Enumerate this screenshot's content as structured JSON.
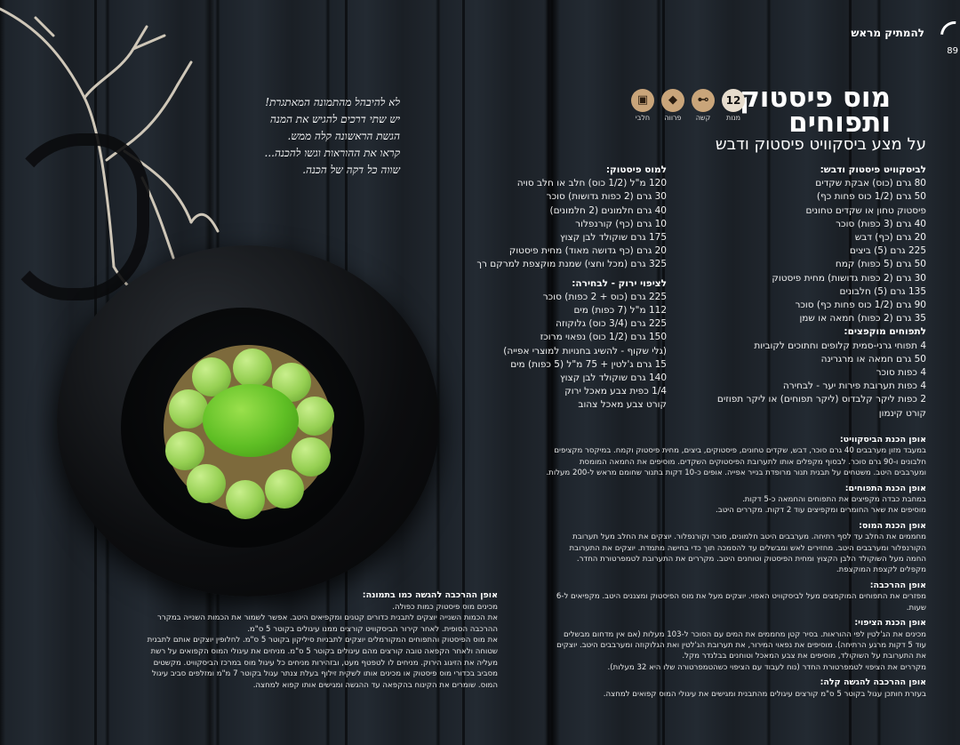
{
  "header": {
    "section_label": "להמתיק מראש",
    "page_number": "89"
  },
  "recipe": {
    "title_line1": "מוס פיסטוק",
    "title_line2": "ותפוחים",
    "subtitle": "על מצע ביסקוויט פיסטוק ודבש"
  },
  "badges": [
    {
      "icon": "time-icon",
      "value": "12",
      "label": "מנות"
    },
    {
      "icon": "difficulty-icon",
      "value": "",
      "label": "קשה"
    },
    {
      "icon": "fish-icon",
      "value": "",
      "label": "פרווה"
    },
    {
      "icon": "dairy-icon",
      "value": "",
      "label": "חלבי"
    }
  ],
  "biscuit": {
    "heading": "לביסקוויט פיסטוק ודבש:",
    "items": [
      "80 גרם (כוס) אבקת שקדים",
      "50 גרם (1/2 כוס פחות כף)",
      "פיסטוק טחון או שקדים טחונים",
      "40 גרם (3 כפות) סוכר",
      "20 גרם (כף) דבש",
      "225 גרם (5) ביצים",
      "50 גרם (5 כפות) קמח",
      "30 גרם (2 כפות גדושות) מחית פיסטוק",
      "135 גרם (5) חלבונים",
      "90 גרם (1/2 כוס פחות כף) סוכר",
      "35 גרם (2 כפות) חמאה או שמן"
    ]
  },
  "apples": {
    "heading": "לתפוחים מוקפצים:",
    "items": [
      "4 תפוחי גרני-סמית קלופים וחתוכים לקוביות",
      "50 גרם חמאה או מרגרינה",
      "4 כפות סוכר",
      "4 כפות תערובת פירות יער - לבחירה",
      "2 כפות ליקר קלבדוס (ליקר תפוחים) או ליקר תפוזים",
      "קורט קינמון"
    ]
  },
  "mousse": {
    "heading": "למוס פיסטוק:",
    "items": [
      "120 מ\"ל (1/2 כוס) חלב או חלב סויה",
      "30 גרם (2 כפות גדושות) סוכר",
      "40 גרם חלמונים (2 חלמונים)",
      "10 גרם (כף) קורנפלור",
      "175 גרם שוקולד לבן קצוץ",
      "20 גרם (כף גדושה מאוד) מחית פיסטוק",
      "325 גרם (מכל וחצי) שמנת מוקצפת למרקם רך"
    ]
  },
  "glaze": {
    "heading": "לציפוי ירוק - לבחירה:",
    "items": [
      "225 גרם (כוס + 2 כפות) סוכר",
      "112 מ\"ל (7 כפות) מים",
      "225 גרם (3/4 כוס) גלוקוזה",
      "150 גרם (1/2 כוס) נפאוי מרוכז",
      "(גלי שקוף - להשיג בחנויות למוצרי אפייה)",
      "15 גרם ג'לטין + 75 מ\"ל (5 כפות) מים",
      "140 גרם שוקולד לבן קצוץ",
      "1/4 כפית צבע מאכל ירוק",
      "קורט צבע מאכל צהוב"
    ]
  },
  "steps": [
    {
      "heading": "אופן הכנת הביסקוויט:",
      "lines": [
        "במעבד מזון מערבבים 40 גרם סוכר, דבש, שקדים טחונים, פיסטוקים, ביצים, מחית פיסטוק וקמח. במיקסר מקציפים",
        "חלבונים ו-90 גרם סוכר. לבסוף מקפלים אותו לתערובת הפיסטוקים השקדים. מוסיפים את החמאה המומסת",
        "ומערבבים היטב. משטחים על תבנית תנור מרופדת בנייר אפייה. אופים כ-10 דקות בתנור שחומם מראש ל-200 מעלות."
      ]
    },
    {
      "heading": "אופן הכנת התפוחים:",
      "lines": [
        "במחבת כבדה מקפיצים את התפוחים והחמאה כ-5 דקות.",
        "מוסיפים את שאר החומרים ומקפיצים עוד 2 דקות. מקררים היטב."
      ]
    },
    {
      "heading": "אופן הכנת המוס:",
      "lines": [
        "מחממים את החלב עד לסף רתיחה. מערבבים היטב חלמונים, סוכר וקורנפלור. יוצקים את החלב מעל תערובת",
        "הקורנפלור ומערבבים היטב. מחזירים לאש ומבשלים עד להסמכה תוך כדי בחישה מתמדת. יוצקים את התערובת",
        "החמה מעל השוקולד הלבן הקצוץ ומחית הפיסטוק וטוחנים היטב. מקררים את התערובת לטמפרטורת החדר.",
        "מקפלים לקצפת המוקצפת."
      ]
    },
    {
      "heading": "אופן ההרכבה:",
      "lines": [
        "מפזרים את התפוחים המוקפצים מעל לביסקוויט האפוי. יוצקים מעל את מוס הפיסטוק ומצננים היטב. מקפיאים ל-6 שעות."
      ]
    },
    {
      "heading": "אופן הכנת הציפוי:",
      "lines": [
        "מכינים את הג'לטין לפי ההוראות. בסיר קטן מחממים את המים עם הסוכר ל-103 מעלות (אם אין מדחום מבשלים",
        "עוד 5 דקות מרגע הרתיחה). מוסיפים את נפאוי המירור, את תערובת הג'לטין ואת הגלוקוזה ומערבבים היטב. יוצקים",
        "את התערובת על השוקולד, מוסיפים את צבע המאכל וטוחנים בבלנדר מקל.",
        "מקררים את הציפוי לטמפרטורת החדר (נוח לעבוד עם הציפוי כשהטמפרטורה שלו היא 32 מעלות)."
      ]
    },
    {
      "heading": "אופן ההרכבה להגשה קלה:",
      "lines": [
        "בעזרת חותכן עגול בקוטר 5 ס\"מ קורצים עיגולים מהתבנית ומגישים את עיגולי המוס קפואים למחצה."
      ]
    }
  ],
  "quote": {
    "lines": [
      "לא להיבהל מהתמונה המאתגרת!",
      "יש שתי דרכים להגיש את המנה",
      "הגשת הראשונה קלה ממש.",
      "קראו את ההוראות וגשו להכנה...",
      "שווה כל דקה של הכנה."
    ]
  },
  "serving": {
    "heading": "אופן ההרכבה להגשה כמו בתמונה:",
    "lines": [
      "מכינים מוס פיסטוק כמות כפולה.",
      "את הכמות השנייה יוצקים לתבנית כדורים קטנים ומקפיאים היטב. אפשר לשמור את הכמות השנייה במקרר",
      "ההרכבה הסופית. לאחר קירור הביסקוויט קורצים ממנו עיגולים בקוטר 5 ס\"מ.",
      "את מוס הפיסטוק והתפוחים המקורמלים יוצקים לתבניות סיליקון בקוטר 5 ס\"מ. לחלופין יוצקים אותם לתבנית",
      "שטוחה ולאחר הקפאה טובה קורצים מהם עיגולים בקוטר 5 ס\"מ. מניחים את עיגולי המוס הקפואים על רשת",
      "מעליה את הזיגוג הירוק. מניחים לו לטפטף מעט, ובזהירות מניחים כל עיגול מוס במרכז הביסקוויט. מקשטים",
      "מסביב בכדורי מוס פיסטוק או מכינים אותו לשקית זילוף בעלת צנתר עגול בקוטר 7 מ\"מ ומזלפים סביב עיגול",
      "המוס. שומרים את הקינוח בהקפאה עד ההגשה ומגישים אותו קפוא למחצה."
    ]
  }
}
